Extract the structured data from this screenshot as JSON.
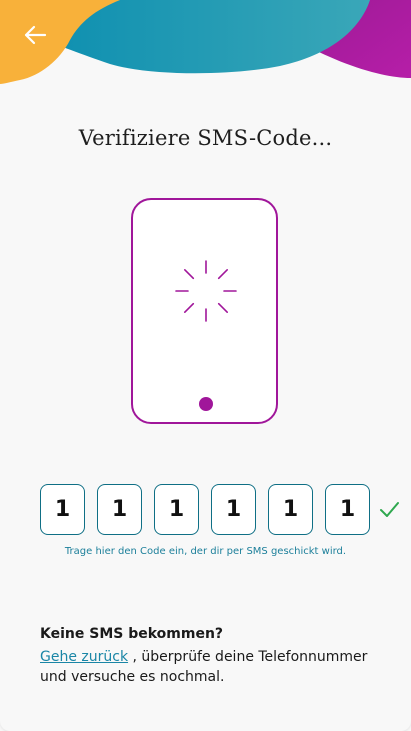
{
  "header": {
    "back_label": "",
    "colors": {
      "orange": "#f8b13a",
      "teal": "#1a9cb5",
      "purple": "#a0169a"
    }
  },
  "title": "Verifiziere SMS-Code...",
  "illustration": {
    "phone_color": "#a0169a"
  },
  "code": {
    "digits": [
      "1",
      "1",
      "1",
      "1",
      "1",
      "1"
    ],
    "valid": true,
    "hint": "Trage hier den Code ein, der dir per SMS geschickt wird."
  },
  "help": {
    "title": "Keine SMS bekommen?",
    "link_text": "Gehe zurück",
    "rest_text": ", überprüfe deine Telefonnummer und versuche es nochmal."
  }
}
